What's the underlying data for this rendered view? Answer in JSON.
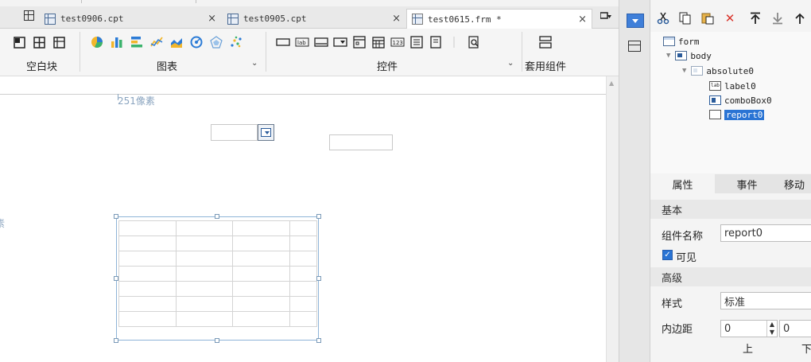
{
  "tabs": [
    {
      "label": "test0906.cpt",
      "close": "×"
    },
    {
      "label": "test0905.cpt",
      "close": "×"
    },
    {
      "label": "test0615.frm *",
      "close": "×"
    }
  ],
  "toolbar": {
    "groups": [
      {
        "label": "空白块"
      },
      {
        "label": "图表",
        "chevron": "⌄"
      },
      {
        "label": "控件",
        "chevron": "⌄"
      },
      {
        "label": "套用组件"
      }
    ]
  },
  "canvas": {
    "ruler_top_label": "251像素",
    "ruler_left_label": "素",
    "report_rows": 7,
    "report_cols": 4
  },
  "tree": {
    "nodes": [
      {
        "label": "form"
      },
      {
        "label": "body",
        "toggle": "▼"
      },
      {
        "label": "absolute0",
        "toggle": "▼"
      },
      {
        "label": "label0"
      },
      {
        "label": "comboBox0"
      },
      {
        "label": "report0"
      }
    ]
  },
  "props": {
    "tabs": [
      "属性",
      "事件",
      "移动"
    ],
    "section_basic": "基本",
    "name_label": "组件名称",
    "name_value": "report0",
    "visible_label": "可见",
    "visible_check": "✓",
    "section_advanced": "高级",
    "style_label": "样式",
    "style_value": "标准",
    "padding_label": "内边距",
    "padding_top": "0",
    "padding_bottom": "0",
    "top_label": "上",
    "bottom_label": "下"
  },
  "colors": {
    "selection": "#2a74d4",
    "report_border": "#8fb4d8",
    "ruler_text": "#8aa4bf"
  }
}
